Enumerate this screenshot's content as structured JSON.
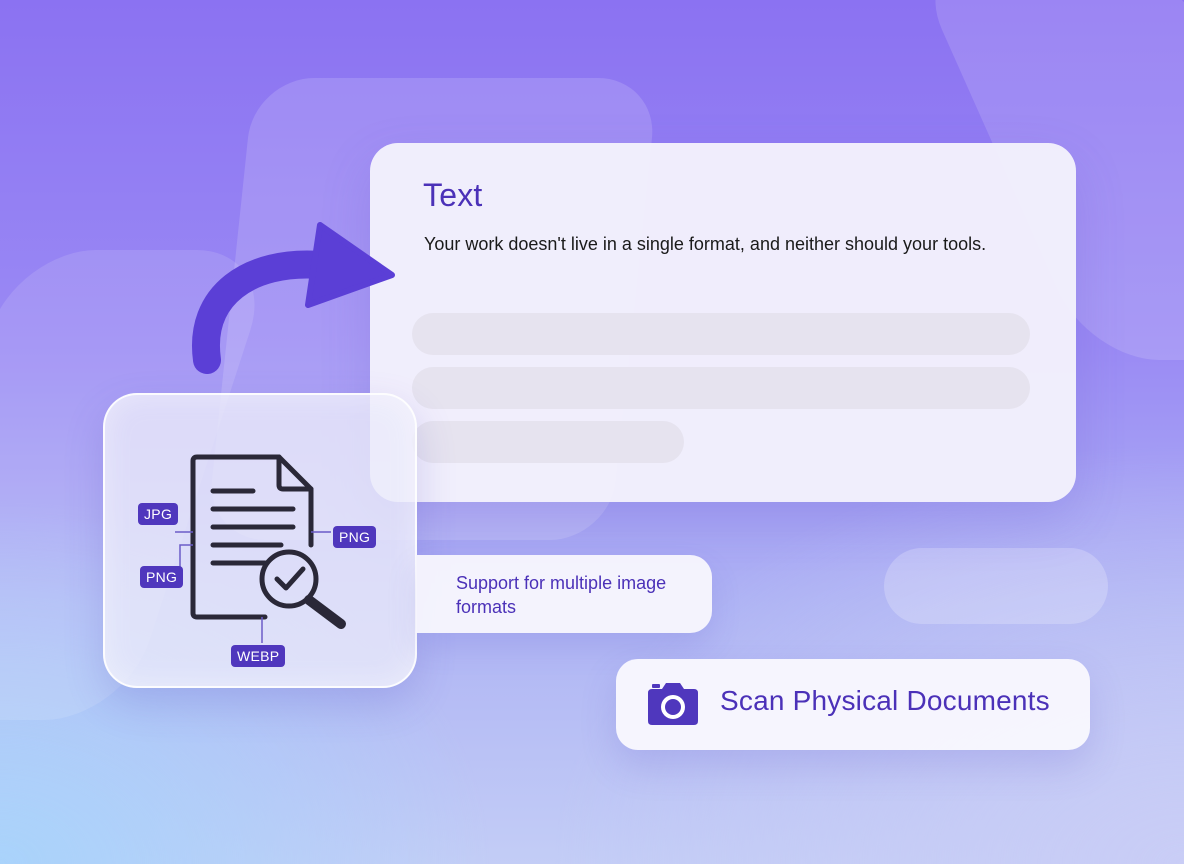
{
  "text_card": {
    "title": "Text",
    "description": "Your work doesn't live in a single format, and neither should your tools."
  },
  "formats": {
    "jpg": "JPG",
    "png_right": "PNG",
    "png_left": "PNG",
    "webp": "WEBP"
  },
  "support": {
    "label": "Support for multiple image formats"
  },
  "scan": {
    "label": "Scan Physical Documents",
    "icon": "camera-icon"
  },
  "colors": {
    "accent": "#4b31b8",
    "tag": "#4f37bd"
  }
}
